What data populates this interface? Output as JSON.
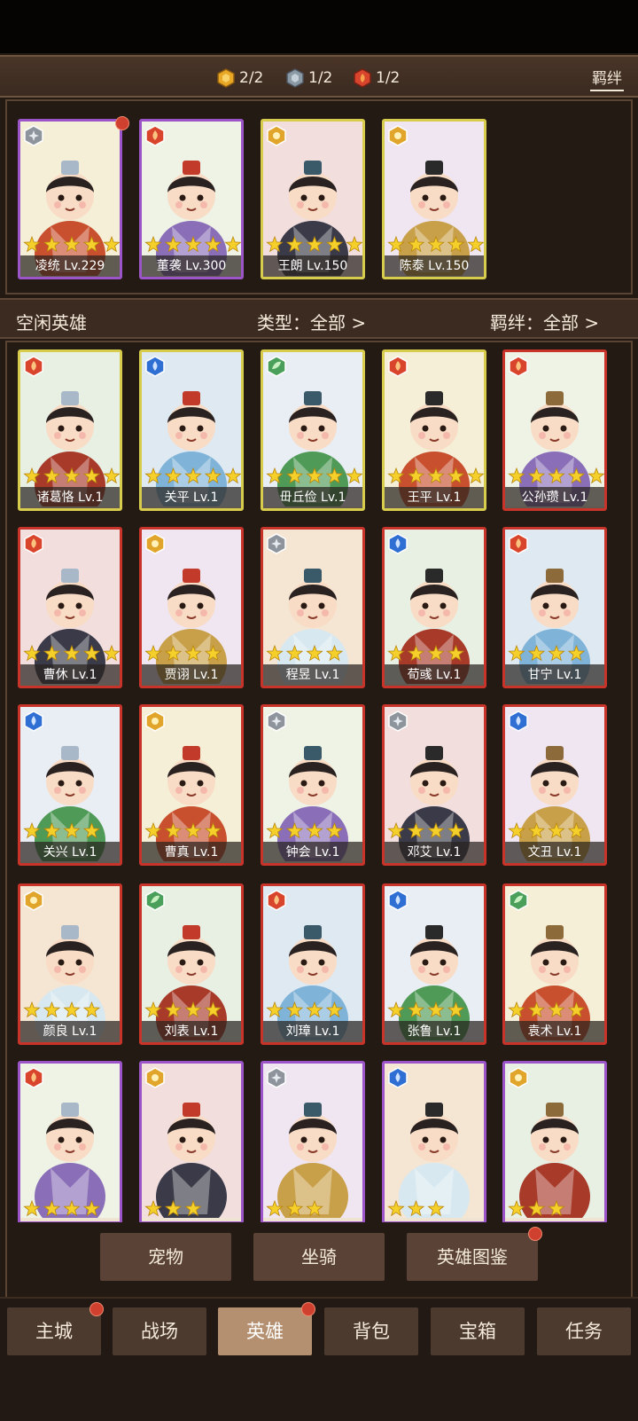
{
  "resources": {
    "gold": {
      "count": "2/2",
      "color": "#e8a825",
      "icon": "gold-hex-gem-icon"
    },
    "silver": {
      "count": "1/2",
      "color": "#8c9aa6",
      "icon": "silver-hex-gem-icon"
    },
    "red": {
      "count": "1/2",
      "color": "#d8452c",
      "icon": "red-hex-gem-icon"
    },
    "bond_label": "羁绊"
  },
  "team": [
    {
      "name": "凌统 Lv.229",
      "frame": "purple",
      "element": "silver",
      "stars": 5
    },
    {
      "name": "董袭 Lv.300",
      "frame": "purple",
      "element": "red",
      "stars": 5
    },
    {
      "name": "王朗 Lv.150",
      "frame": "gold",
      "element": "gold",
      "stars": 5
    },
    {
      "name": "陈泰 Lv.150",
      "frame": "gold",
      "element": "gold",
      "stars": 5
    }
  ],
  "filter": {
    "title": "空闲英雄",
    "type_label": "类型：全部 >",
    "bond_label": "羁绊：全部 >"
  },
  "heroes": [
    {
      "name": "诸葛恪 Lv.1",
      "frame": "gold",
      "element": "red",
      "stars": 5
    },
    {
      "name": "关平 Lv.1",
      "frame": "gold",
      "element": "blue",
      "stars": 5
    },
    {
      "name": "毌丘俭 Lv.1",
      "frame": "gold",
      "element": "green",
      "stars": 5
    },
    {
      "name": "王平 Lv.1",
      "frame": "gold",
      "element": "red",
      "stars": 5
    },
    {
      "name": "公孙瓒 Lv.1",
      "frame": "red",
      "element": "red",
      "stars": 5
    },
    {
      "name": "曹休 Lv.1",
      "frame": "red",
      "element": "red",
      "stars": 5
    },
    {
      "name": "贾诩 Lv.1",
      "frame": "red",
      "element": "gold",
      "stars": 4
    },
    {
      "name": "程昱 Lv.1",
      "frame": "red",
      "element": "silver",
      "stars": 4
    },
    {
      "name": "荀彧 Lv.1",
      "frame": "red",
      "element": "blue",
      "stars": 4
    },
    {
      "name": "甘宁 Lv.1",
      "frame": "red",
      "element": "red",
      "stars": 4
    },
    {
      "name": "关兴 Lv.1",
      "frame": "red",
      "element": "blue",
      "stars": 4
    },
    {
      "name": "曹真 Lv.1",
      "frame": "red",
      "element": "gold",
      "stars": 4
    },
    {
      "name": "钟会 Lv.1",
      "frame": "red",
      "element": "silver",
      "stars": 4
    },
    {
      "name": "邓艾 Lv.1",
      "frame": "red",
      "element": "silver",
      "stars": 4
    },
    {
      "name": "文丑 Lv.1",
      "frame": "red",
      "element": "blue",
      "stars": 4
    },
    {
      "name": "颜良 Lv.1",
      "frame": "red",
      "element": "gold",
      "stars": 4
    },
    {
      "name": "刘表 Lv.1",
      "frame": "red",
      "element": "green",
      "stars": 4
    },
    {
      "name": "刘璋 Lv.1",
      "frame": "red",
      "element": "red",
      "stars": 4
    },
    {
      "name": "张鲁 Lv.1",
      "frame": "red",
      "element": "blue",
      "stars": 4
    },
    {
      "name": "袁术 Lv.1",
      "frame": "red",
      "element": "green",
      "stars": 4
    },
    {
      "name": "",
      "frame": "purple",
      "element": "red",
      "stars": 4
    },
    {
      "name": "",
      "frame": "purple",
      "element": "gold",
      "stars": 3
    },
    {
      "name": "",
      "frame": "purple",
      "element": "silver",
      "stars": 3
    },
    {
      "name": "",
      "frame": "purple",
      "element": "blue",
      "stars": 3
    },
    {
      "name": "",
      "frame": "purple",
      "element": "gold",
      "stars": 3
    }
  ],
  "sub_buttons": {
    "pet": "宠物",
    "mount": "坐骑",
    "codex": "英雄图鉴"
  },
  "nav": {
    "items": [
      "主城",
      "战场",
      "英雄",
      "背包",
      "宝箱",
      "任务"
    ],
    "active": "英雄"
  },
  "colors": {
    "frame_gold": "#d7cc4b",
    "frame_red": "#c8332a",
    "frame_purple": "#9b55c9",
    "elem_red": "#d8452c",
    "elem_blue": "#2f6fd3",
    "elem_green": "#4aa05a",
    "elem_gold": "#e0a52a",
    "elem_silver": "#8e949c",
    "star": "#f5cf2a"
  }
}
